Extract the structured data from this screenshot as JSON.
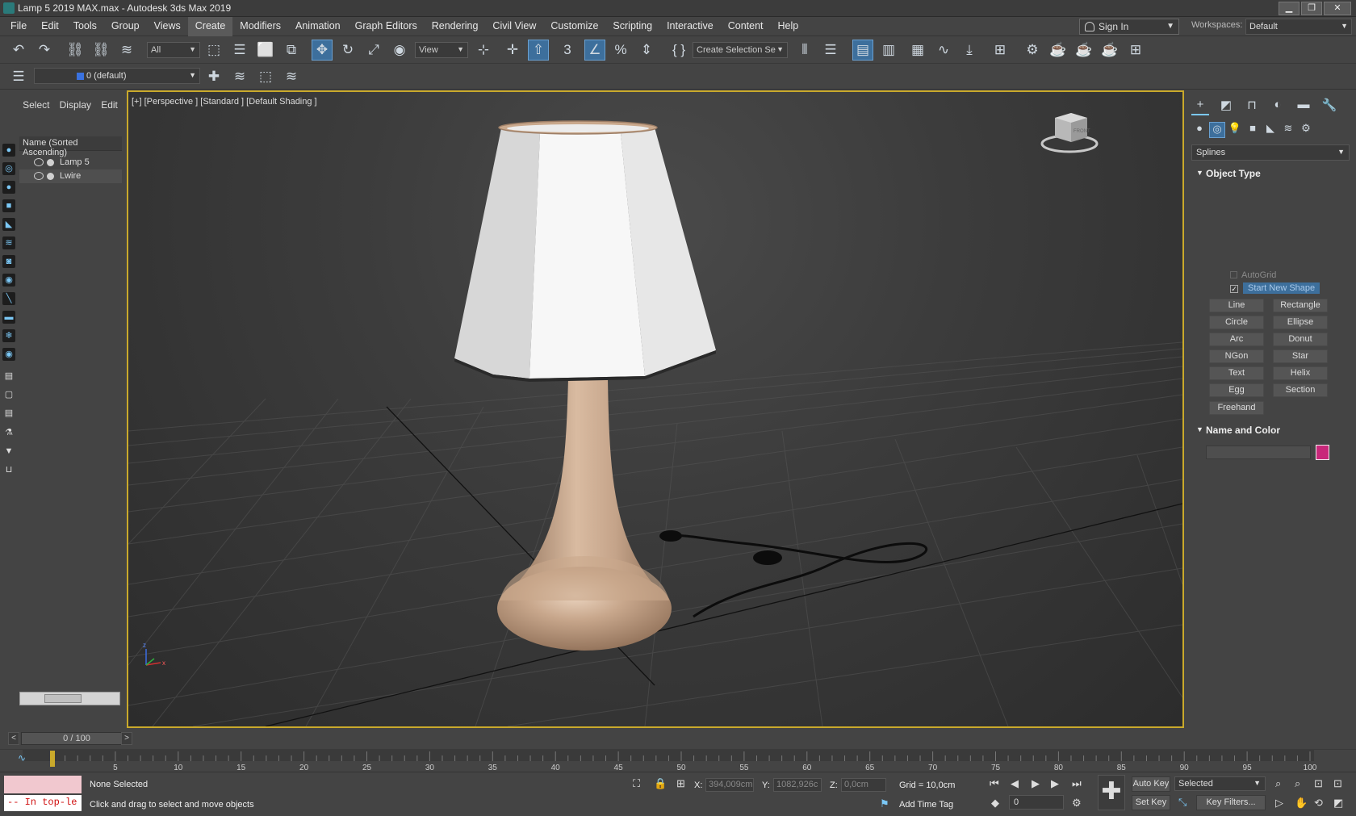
{
  "window": {
    "title": "Lamp 5 2019 MAX.max - Autodesk 3ds Max 2019"
  },
  "menu": [
    "File",
    "Edit",
    "Tools",
    "Group",
    "Views",
    "Create",
    "Modifiers",
    "Animation",
    "Graph Editors",
    "Rendering",
    "Civil View",
    "Customize",
    "Scripting",
    "Interactive",
    "Content",
    "Help"
  ],
  "account": {
    "sign_in": "Sign In",
    "workspaces_label": "Workspaces:",
    "workspace": "Default"
  },
  "toolbar": {
    "filter": "All",
    "ref_coord": "View",
    "selection_set": "Create Selection Se",
    "snap_value": "3"
  },
  "layer": {
    "current": "0 (default)"
  },
  "explorer": {
    "tabs": [
      "Select",
      "Display",
      "Edit"
    ],
    "header": "Name (Sorted Ascending)",
    "items": [
      {
        "name": "Lamp 5",
        "selected": false
      },
      {
        "name": "Lwire",
        "selected": true
      }
    ]
  },
  "viewport": {
    "label": "[+] [Perspective ] [Standard ] [Default Shading ]",
    "viewcube_face": "FRONT",
    "axis_x": "x",
    "axis_z": "z"
  },
  "command_panel": {
    "category": "Splines",
    "object_type_title": "Object Type",
    "autogrid": "AutoGrid",
    "start_new_shape": "Start New Shape",
    "start_new_shape_checked": true,
    "buttons": [
      "Line",
      "Rectangle",
      "Circle",
      "Ellipse",
      "Arc",
      "Donut",
      "NGon",
      "Star",
      "Text",
      "Helix",
      "Egg",
      "Section",
      "Freehand"
    ],
    "name_color_title": "Name and Color",
    "object_color": "#c8287a"
  },
  "timeline": {
    "position": "0 / 100",
    "ticks": [
      "5",
      "10",
      "15",
      "20",
      "25",
      "30",
      "35",
      "40",
      "45",
      "50",
      "55",
      "60",
      "65",
      "70",
      "75",
      "80",
      "85",
      "90",
      "95",
      "100"
    ]
  },
  "status": {
    "maxscript": "-- In top-le",
    "selection": "None Selected",
    "prompt": "Click and drag to select and move objects",
    "x_label": "X:",
    "x_value": "394,009cm",
    "y_label": "Y:",
    "y_value": "1082,926c",
    "z_label": "Z:",
    "z_value": "0,0cm",
    "grid": "Grid = 10,0cm",
    "add_time_tag": "Add Time Tag",
    "auto_key": "Auto Key",
    "set_key": "Set Key",
    "selected": "Selected",
    "key_filters": "Key Filters...",
    "frame": "0"
  },
  "colors": {
    "viewport_border": "#c9a92b",
    "accent": "#3d6f9c",
    "lamp_shade": "#f2f2f2",
    "lamp_wood": "#c9a88c"
  }
}
